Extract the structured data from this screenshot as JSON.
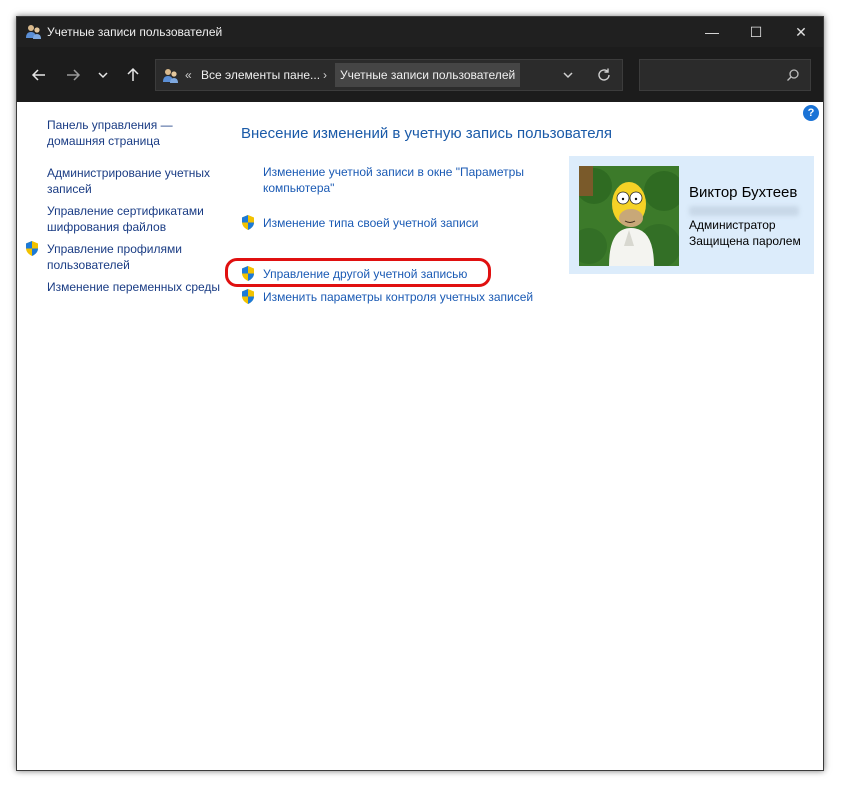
{
  "window": {
    "title": "Учетные записи пользователей"
  },
  "titlebar": {
    "minimize": "—",
    "maximize": "☐",
    "close": "✕"
  },
  "navbar": {
    "back_icon": "arrow-left-icon",
    "forward_icon": "arrow-right-icon",
    "history_icon": "chevron-down-icon",
    "up_icon": "arrow-up-icon",
    "address": {
      "overflow": "«",
      "crumb1": "Все элементы пане...",
      "separator": "›",
      "crumb2": "Учетные записи пользователей"
    },
    "search_placeholder": ""
  },
  "help": {
    "label": "?"
  },
  "sidebar": {
    "items": [
      {
        "label": "Панель управления — домашняя страница",
        "shield": false
      },
      {
        "label": "Администрирование учетных записей",
        "shield": false
      },
      {
        "label": "Управление сертификатами шифрования файлов",
        "shield": false
      },
      {
        "label": "Управление профилями пользователей",
        "shield": true
      },
      {
        "label": "Изменение переменных среды",
        "shield": false
      }
    ]
  },
  "main": {
    "title": "Внесение изменений в учетную запись пользователя",
    "tasks": [
      {
        "label": "Изменение учетной записи в окне \"Параметры компьютера\"",
        "shield": false
      },
      {
        "label": "Изменение типа своей учетной записи",
        "shield": true
      },
      {
        "label": "Управление другой учетной записью",
        "shield": true,
        "highlighted": true
      },
      {
        "label": "Изменить параметры контроля учетных записей",
        "shield": true
      }
    ]
  },
  "user": {
    "name": "Виктор Бухтеев",
    "role": "Администратор",
    "status": "Защищена паролем"
  },
  "colors": {
    "titlebar_bg": "#202020",
    "link": "#1a5ab4",
    "user_panel_bg": "#dcecfb",
    "highlight": "#e01010"
  }
}
